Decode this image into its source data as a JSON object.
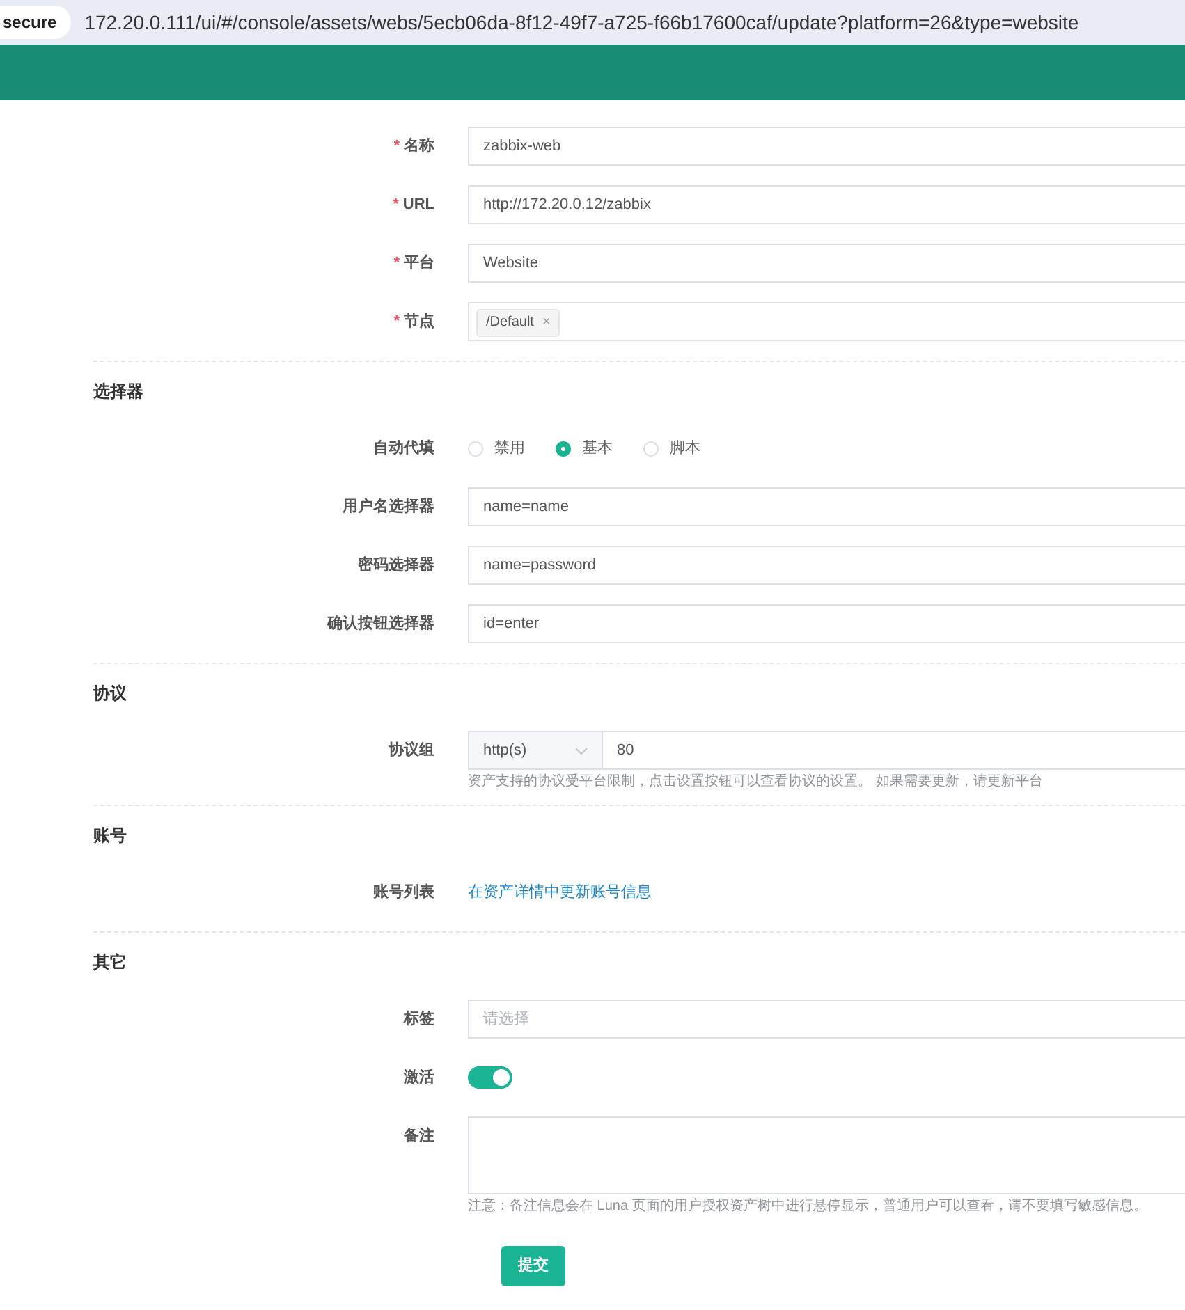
{
  "address_bar": {
    "security_label": "secure",
    "url": "172.20.0.111/ui/#/console/assets/webs/5ecb06da-8f12-49f7-a725-f66b17600caf/update?platform=26&type=website"
  },
  "sections": [
    {
      "fields": [
        {
          "kind": "text",
          "label": "名称",
          "required_mark": "*",
          "value": "zabbix-web"
        },
        {
          "kind": "text",
          "label": "URL",
          "required_mark": "*",
          "value": "http://172.20.0.12/zabbix"
        },
        {
          "kind": "text",
          "label": "平台",
          "required_mark": "*",
          "value": "Website"
        },
        {
          "kind": "tags",
          "label": "节点",
          "required_mark": "*",
          "tags": [
            {
              "label": "/Default",
              "remove": "×"
            }
          ]
        }
      ]
    },
    {
      "title": "选择器",
      "fields": [
        {
          "kind": "radio",
          "label": "自动代填",
          "options": [
            {
              "label": "禁用",
              "selected": false
            },
            {
              "label": "基本",
              "selected": true
            },
            {
              "label": "脚本",
              "selected": false
            }
          ]
        },
        {
          "kind": "text",
          "label": "用户名选择器",
          "value": "name=name"
        },
        {
          "kind": "text",
          "label": "密码选择器",
          "value": "name=password"
        },
        {
          "kind": "text",
          "label": "确认按钮选择器",
          "value": "id=enter"
        }
      ]
    },
    {
      "title": "协议",
      "fields": [
        {
          "kind": "protocol",
          "label": "协议组",
          "protocol": "http(s)",
          "port": "80",
          "help": "资产支持的协议受平台限制，点击设置按钮可以查看协议的设置。 如果需要更新，请更新平台"
        }
      ]
    },
    {
      "title": "账号",
      "fields": [
        {
          "kind": "link",
          "label": "账号列表",
          "link": "在资产详情中更新账号信息"
        }
      ]
    },
    {
      "title": "其它",
      "fields": [
        {
          "kind": "select",
          "label": "标签",
          "placeholder": "请选择"
        },
        {
          "kind": "toggle",
          "label": "激活",
          "on": true
        },
        {
          "kind": "textarea",
          "label": "备注",
          "help": "注意：备注信息会在 Luna 页面的用户授权资产树中进行悬停显示，普通用户可以查看，请不要填写敏感信息。"
        }
      ]
    }
  ],
  "submit": "提交"
}
